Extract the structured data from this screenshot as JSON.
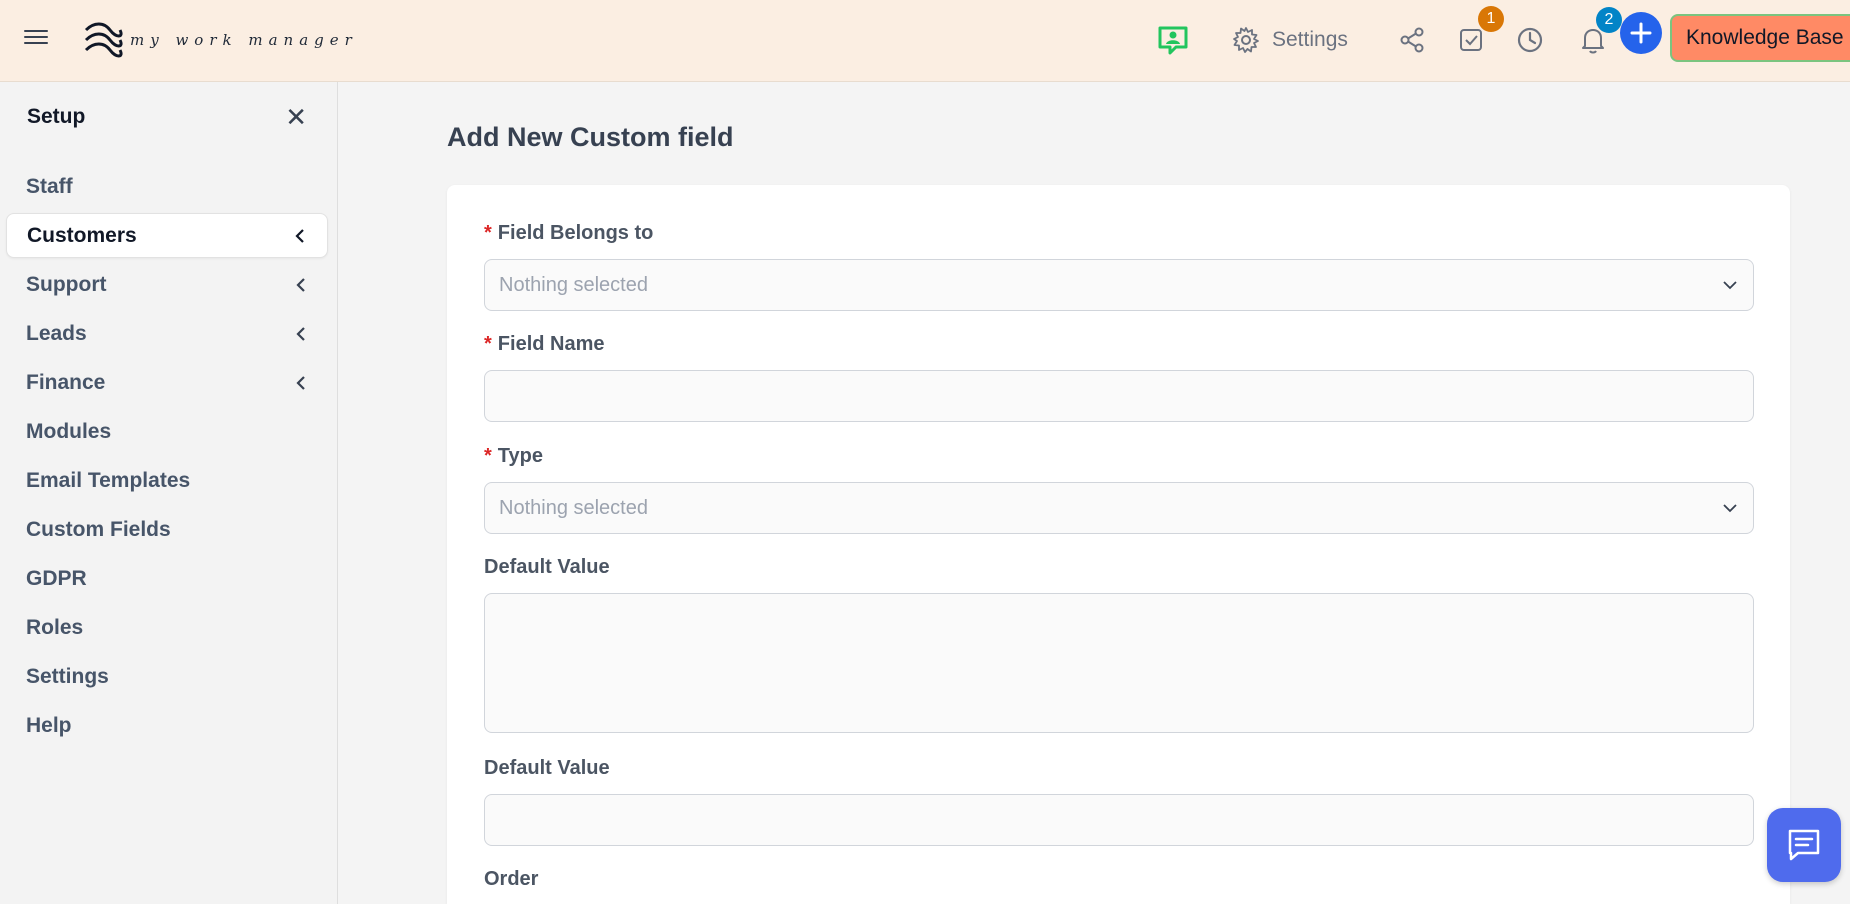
{
  "header": {
    "logo_text": "my work manager",
    "settings_label": "Settings",
    "tasks_badge": "1",
    "notifications_badge": "2",
    "knowledge_base_label": "Knowledge Base",
    "colors": {
      "bar": "#fbeee2",
      "plus": "#2563eb",
      "kb": "#ff8a65",
      "chat_green": "#22c55e"
    }
  },
  "sidebar": {
    "title": "Setup",
    "items": [
      {
        "label": "Staff",
        "has_chevron": false,
        "active": false
      },
      {
        "label": "Customers",
        "has_chevron": true,
        "active": true
      },
      {
        "label": "Support",
        "has_chevron": true,
        "active": false
      },
      {
        "label": "Leads",
        "has_chevron": true,
        "active": false
      },
      {
        "label": "Finance",
        "has_chevron": true,
        "active": false
      },
      {
        "label": "Modules",
        "has_chevron": false,
        "active": false
      },
      {
        "label": "Email Templates",
        "has_chevron": false,
        "active": false
      },
      {
        "label": "Custom Fields",
        "has_chevron": false,
        "active": false
      },
      {
        "label": "GDPR",
        "has_chevron": false,
        "active": false
      },
      {
        "label": "Roles",
        "has_chevron": false,
        "active": false
      },
      {
        "label": "Settings",
        "has_chevron": false,
        "active": false
      },
      {
        "label": "Help",
        "has_chevron": false,
        "active": false
      }
    ]
  },
  "main": {
    "title": "Add New Custom field",
    "form": {
      "field_belongs_to": {
        "label": "Field Belongs to",
        "required": "*",
        "value": "Nothing selected"
      },
      "field_name": {
        "label": "Field Name",
        "required": "*",
        "value": ""
      },
      "type": {
        "label": "Type",
        "required": "*",
        "value": "Nothing selected"
      },
      "default_value_textarea": {
        "label": "Default Value",
        "value": ""
      },
      "default_value_input": {
        "label": "Default Value",
        "value": ""
      },
      "order": {
        "label": "Order"
      }
    }
  },
  "icons": {
    "menu": "hamburger-icon",
    "chat": "chat-person-icon",
    "settings": "gear-icon",
    "share": "share-icon",
    "tasks": "checkbox-icon",
    "timer": "clock-icon",
    "notifications": "bell-icon",
    "add": "plus-icon",
    "close": "close-icon",
    "chevron": "chevron-left-icon",
    "select": "chevron-down-icon",
    "support_chat": "message-icon"
  }
}
